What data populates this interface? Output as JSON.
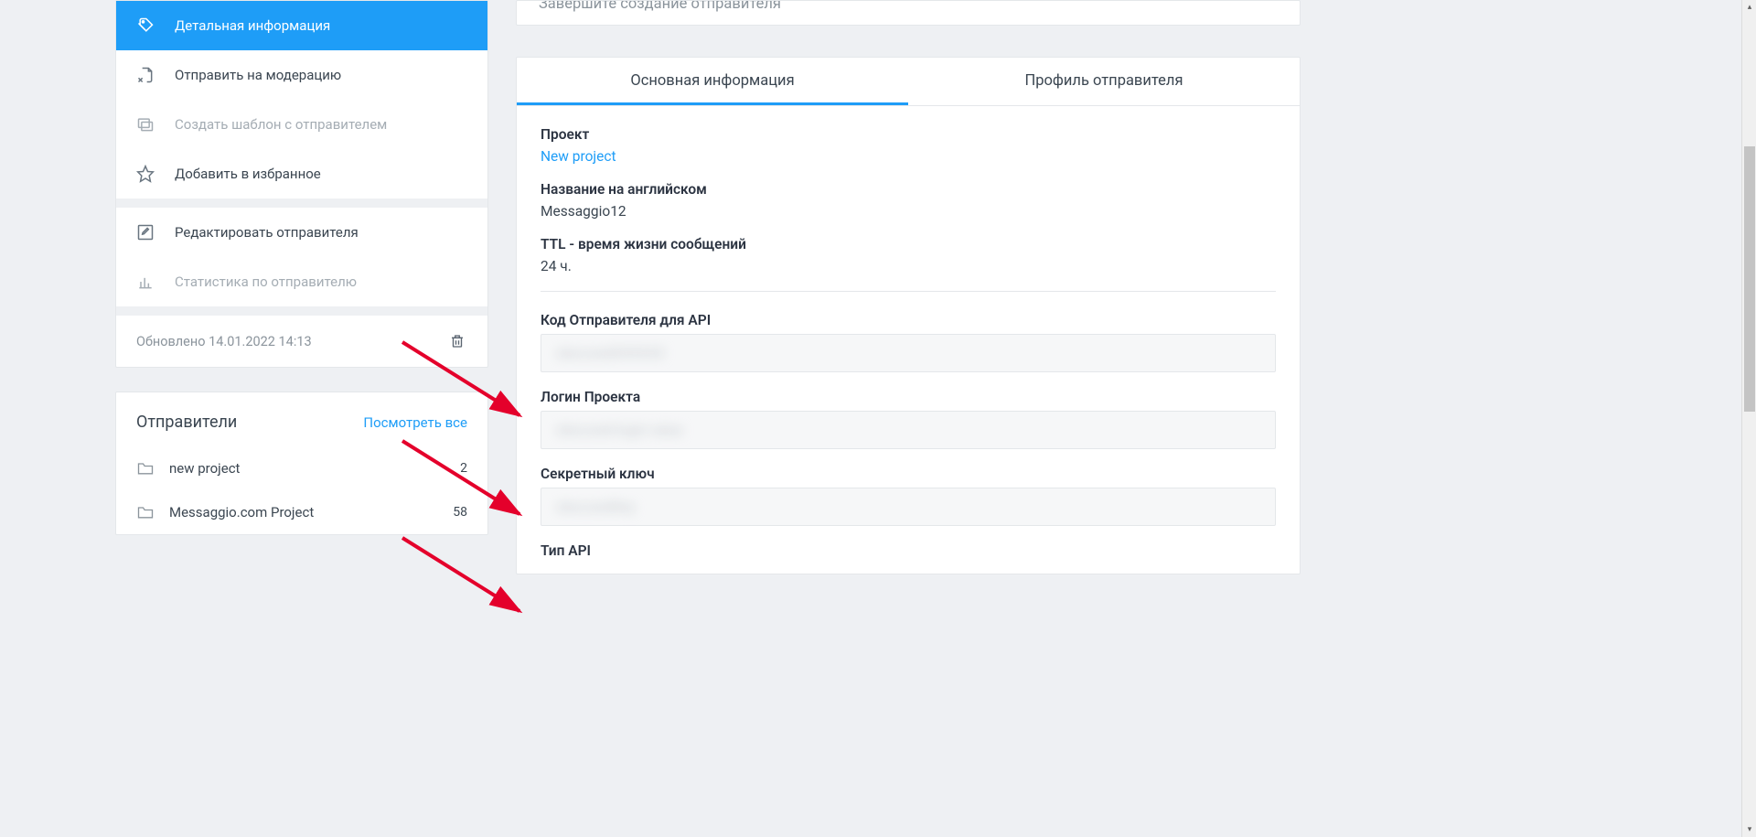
{
  "sidebar": {
    "items": [
      {
        "icon": "tags-icon",
        "label": "Детальная информация",
        "active": true,
        "interact": true
      },
      {
        "icon": "file-send-icon",
        "label": "Отправить на модерацию",
        "interact": true
      },
      {
        "icon": "template-icon",
        "label": "Создать шаблон с отправителем",
        "disabled": true,
        "interact": true
      },
      {
        "icon": "star-icon",
        "label": "Добавить в избранное",
        "interact": true
      }
    ],
    "items2": [
      {
        "icon": "edit-icon",
        "label": "Редактировать отправителя",
        "interact": true
      },
      {
        "icon": "chart-icon",
        "label": "Статистика по отправителю",
        "disabled": true,
        "interact": true
      }
    ],
    "updated_label": "Обновлено 14.01.2022 14:13"
  },
  "senders": {
    "title": "Отправители",
    "view_all": "Посмотреть все",
    "rows": [
      {
        "name": "new project",
        "count": "2"
      },
      {
        "name": "Messaggio.com Project",
        "count": "58"
      }
    ]
  },
  "banner_text": "Завершите создание отправителя",
  "tabs": {
    "main": "Основная информация",
    "profile": "Профиль отправителя"
  },
  "info": {
    "project_label": "Проект",
    "project_value": "New project",
    "name_en_label": "Название на английском",
    "name_en_value": "Messaggio12",
    "ttl_label": "TTL - время жизни сообщений",
    "ttl_value": "24 ч.",
    "api_code_label": "Код Отправителя для API",
    "api_code_value": "obscuredXXXXXX",
    "login_label": "Логин Проекта",
    "login_value": "obscured-login-value",
    "secret_label": "Секретный ключ",
    "secret_value": "obscuredKey",
    "api_type_label": "Тип API"
  }
}
